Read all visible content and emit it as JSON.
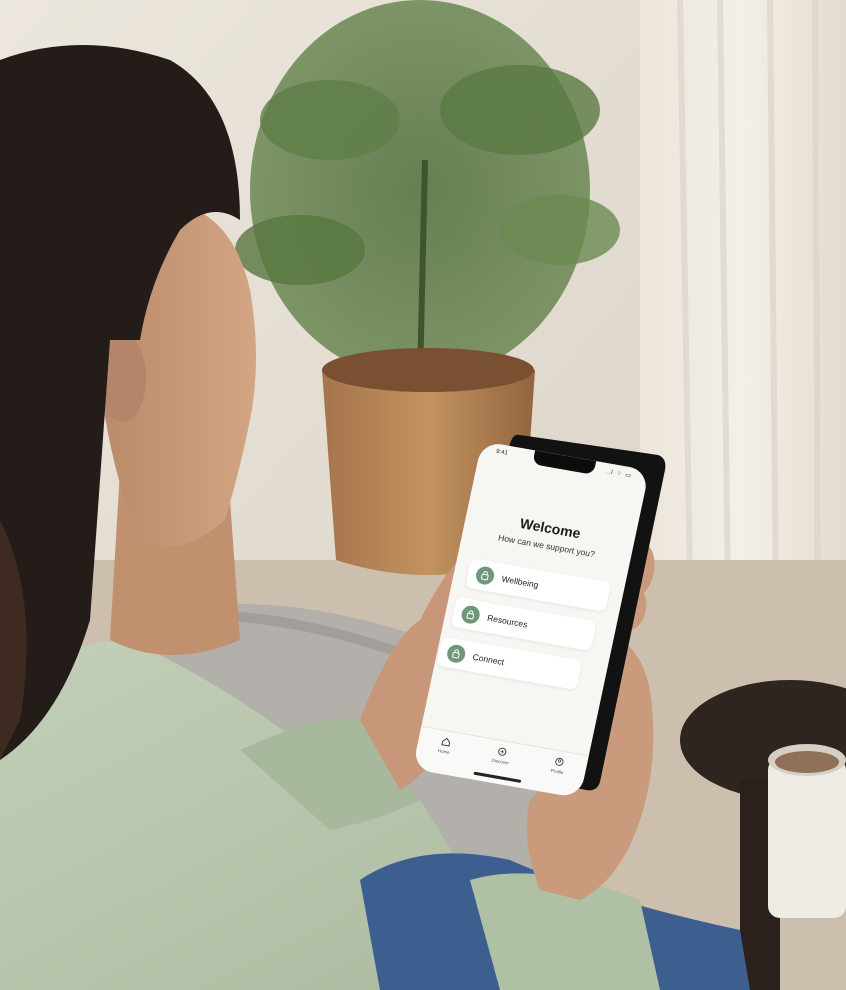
{
  "status_bar": {
    "time": "9:41",
    "icons": "..l ⌔ ▭"
  },
  "welcome": {
    "title": "Welcome",
    "subtitle": "How can we support you?"
  },
  "menu": {
    "items": [
      {
        "label": "Wellbeing",
        "icon": "lock-icon"
      },
      {
        "label": "Resources",
        "icon": "lock-icon"
      },
      {
        "label": "Connect",
        "icon": "lock-icon"
      }
    ]
  },
  "tabs": {
    "items": [
      {
        "label": "Home",
        "icon": "home-icon"
      },
      {
        "label": "Discover",
        "icon": "compass-icon"
      },
      {
        "label": "Profile",
        "icon": "profile-icon"
      }
    ]
  },
  "colors": {
    "accent": "#6e9879",
    "sweater": "#b7c6ac",
    "wall": "#e4ded4"
  }
}
